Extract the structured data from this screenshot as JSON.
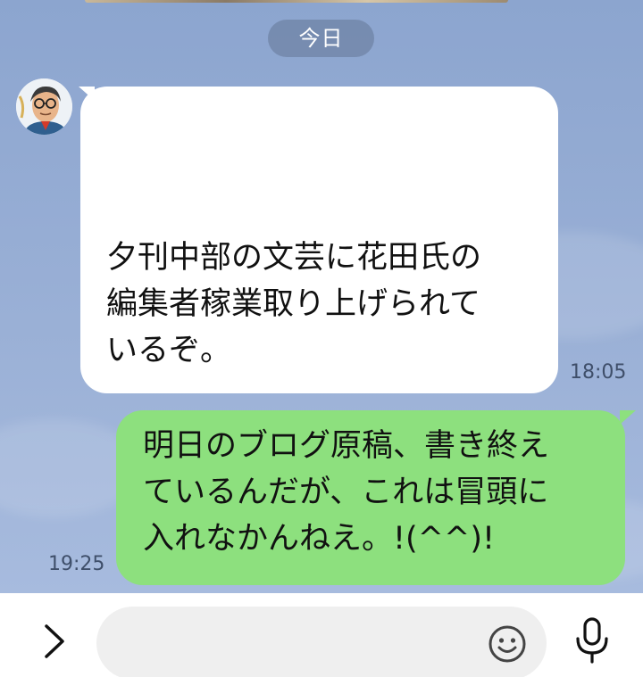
{
  "chat": {
    "date_label": "今日",
    "messages": [
      {
        "direction": "received",
        "text": "夕刊中部の文芸に花田氏の\n編集者稼業取り上げられて\nいるぞ。",
        "time": "18:05"
      },
      {
        "direction": "sent",
        "text": "明日のブログ原稿、書き終え\nているんだが、これは冒頭に\n入れなかんねえ。!(^^)!",
        "time": "19:25"
      }
    ]
  },
  "input_bar": {
    "expand_icon": "chevron-right-icon",
    "emoji_icon": "smiley-icon",
    "mic_icon": "microphone-icon",
    "message_value": "",
    "message_placeholder": ""
  },
  "colors": {
    "chat_background": "#8ca5cf",
    "received_bubble": "#ffffff",
    "sent_bubble": "#8de07e",
    "date_pill": "#64769699",
    "timestamp": "#3f4f6a"
  }
}
